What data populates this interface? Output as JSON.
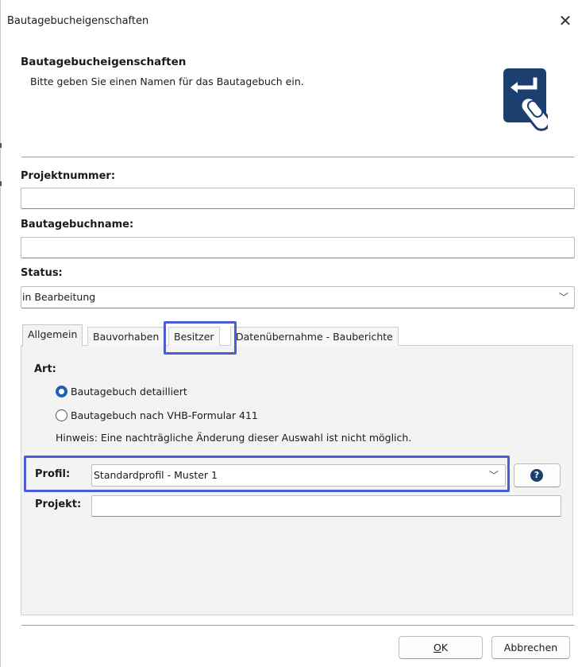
{
  "window": {
    "title": "Bautagebucheigenschaften",
    "close_symbol": "✕"
  },
  "header": {
    "title": "Bautagebucheigenschaften",
    "subtitle": "Bitte geben Sie einen Namen für das Bautagebuch ein.",
    "icon": "touch-enter-icon"
  },
  "fields": {
    "projektnummer": {
      "label": "Projektnummer:",
      "value": ""
    },
    "bautagebuchname": {
      "label": "Bautagebuchname:",
      "value": ""
    },
    "status": {
      "label": "Status:",
      "value": "in Bearbeitung"
    }
  },
  "tabs": [
    {
      "label": "Allgemein",
      "active": true
    },
    {
      "label": "Bauvorhaben",
      "active": false
    },
    {
      "label": "Besitzer",
      "active": false
    },
    {
      "label": "Datenübernahme - Bauberichte",
      "active": false
    }
  ],
  "allgemein": {
    "art_label": "Art:",
    "options": [
      {
        "label": "Bautagebuch detailliert",
        "selected": true
      },
      {
        "label": "Bautagebuch nach VHB-Formular 411",
        "selected": false
      }
    ],
    "hint": "Hinweis: Eine nachträgliche Änderung dieser Auswahl ist nicht möglich.",
    "profil_label": "Profil:",
    "profil_value": "Standardprofil - Muster 1",
    "help_symbol": "?",
    "projekt_label": "Projekt:",
    "projekt_value": ""
  },
  "buttons": {
    "ok": "OK",
    "ok_mnemonic": "O",
    "ok_rest": "K",
    "cancel": "Abbrechen"
  },
  "colors": {
    "highlight": "#4f5bd5",
    "radio_selected": "#1f5fb9",
    "icon_dark": "#1b3f6e"
  }
}
